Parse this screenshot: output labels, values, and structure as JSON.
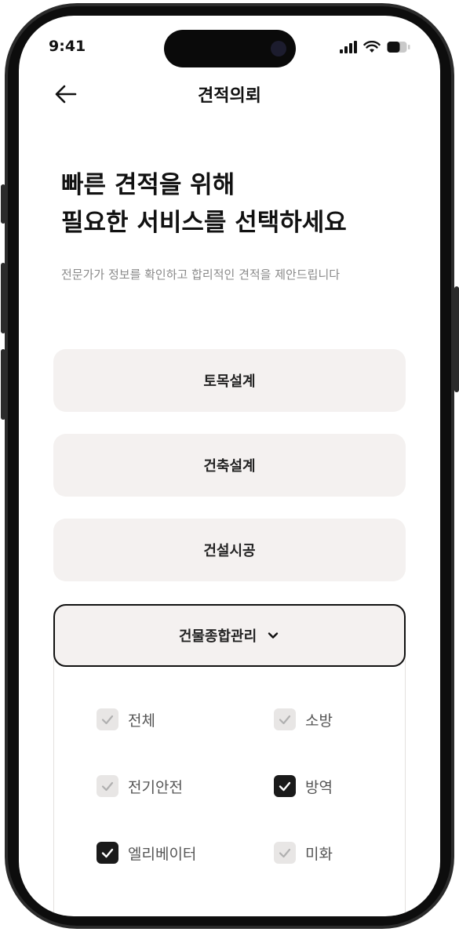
{
  "status": {
    "time": "9:41"
  },
  "header": {
    "title": "견적의뢰",
    "back_icon": "arrow-left-icon"
  },
  "headline": {
    "line1": "빠른 견적을 위해",
    "line2": "필요한 서비스를 선택하세요"
  },
  "subtitle": "전문가가 정보를 확인하고 합리적인 견적을 제안드립니다",
  "options": [
    {
      "label": "토목설계"
    },
    {
      "label": "건축설계"
    },
    {
      "label": "건설시공"
    },
    {
      "label": "건물종합관리",
      "expanded": true
    }
  ],
  "sub_options": [
    {
      "label": "전체",
      "checked": false
    },
    {
      "label": "소방",
      "checked": false
    },
    {
      "label": "전기안전",
      "checked": false
    },
    {
      "label": "방역",
      "checked": true
    },
    {
      "label": "엘리베이터",
      "checked": true
    },
    {
      "label": "미화",
      "checked": false
    }
  ],
  "colors": {
    "option_bg": "#f4f1f0",
    "checked_bg": "#1a1a1a",
    "unchecked_bg": "#e8e6e5"
  }
}
